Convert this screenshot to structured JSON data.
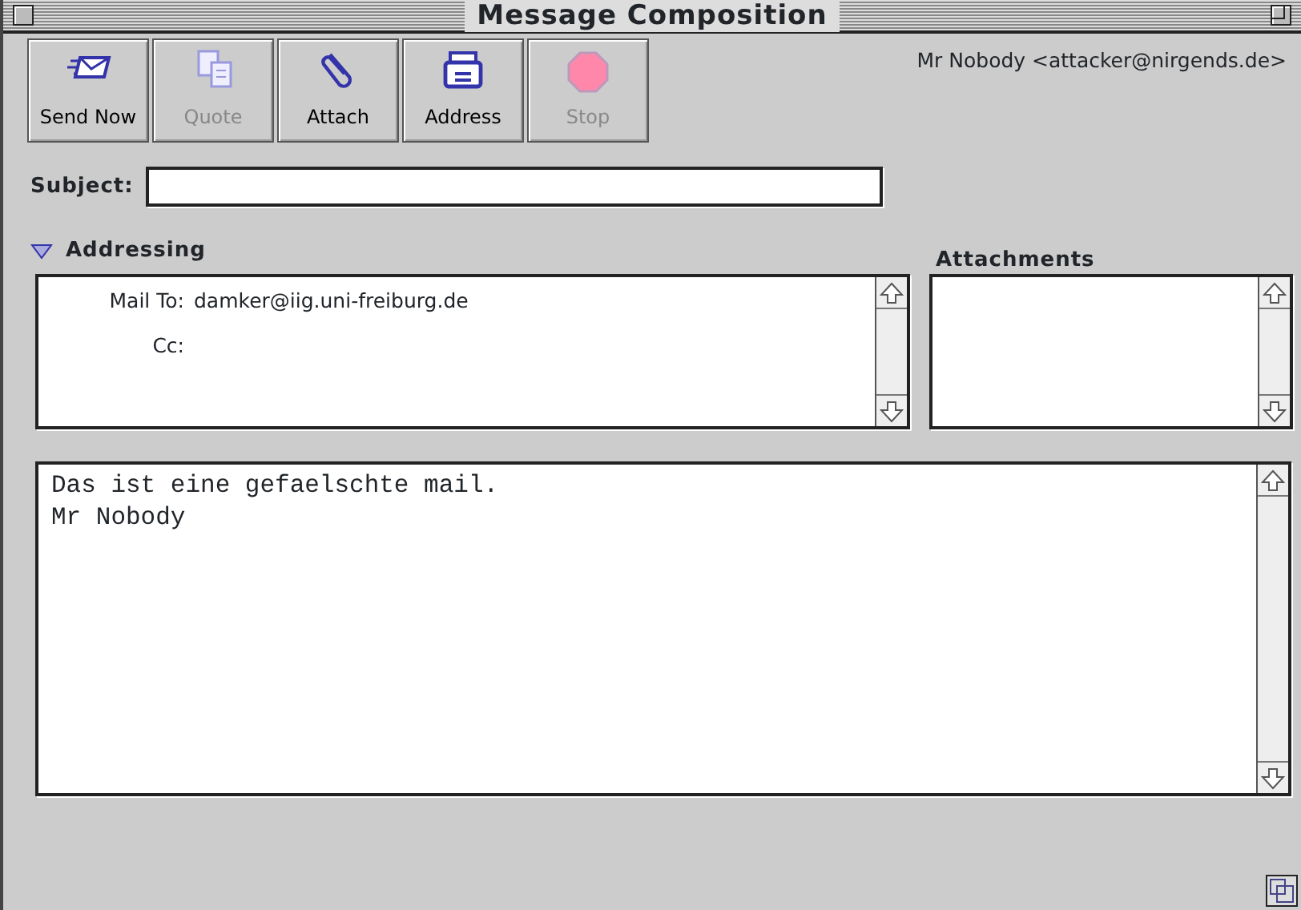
{
  "window": {
    "title": "Message Composition"
  },
  "toolbar": [
    {
      "label": "Send Now",
      "kind": "send",
      "disabled": false
    },
    {
      "label": "Quote",
      "kind": "quote",
      "disabled": true
    },
    {
      "label": "Attach",
      "kind": "attach",
      "disabled": false
    },
    {
      "label": "Address",
      "kind": "address",
      "disabled": false
    },
    {
      "label": "Stop",
      "kind": "stop",
      "disabled": true
    }
  ],
  "sender": "Mr Nobody <attacker@nirgends.de>",
  "subject": {
    "label": "Subject:"
  },
  "addressing": {
    "label": "Addressing",
    "expanded": true,
    "fields": [
      {
        "label": "Mail To:",
        "value": "damker@iig.uni-freiburg.de"
      },
      {
        "label": "Cc:"
      }
    ]
  },
  "attachments": {
    "label": "Attachments"
  },
  "body": {
    "lines": [
      "Das ist eine gefaelschte mail.",
      "Mr Nobody"
    ]
  }
}
